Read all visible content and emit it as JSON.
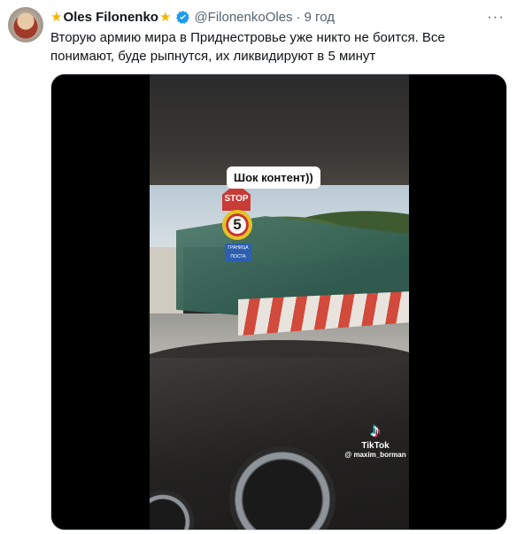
{
  "tweet": {
    "author_name": "Oles Filonenko",
    "author_handle": "@FilonenkoOles",
    "separator": "·",
    "time": "9 год",
    "more_label": "···",
    "text": "Вторую армию мира в Приднестровье уже никто не боится. Все понимают, буде рыпнутся, их ликвидируют в 5 минут"
  },
  "media": {
    "caption": "Шок контент))",
    "watermark_brand": "TikTok",
    "watermark_user": "@ maxim_borman",
    "sign_stop": "STOP",
    "sign_speed": "5",
    "sign_border": "ГРАНИЦА ПОСТА"
  },
  "icons": [
    "star-icon",
    "verified-badge-icon",
    "more-icon",
    "tiktok-logo-icon"
  ],
  "colors": {
    "verified": "#1d9bf0",
    "star": "#f4b400",
    "secondary_text": "#536471"
  }
}
